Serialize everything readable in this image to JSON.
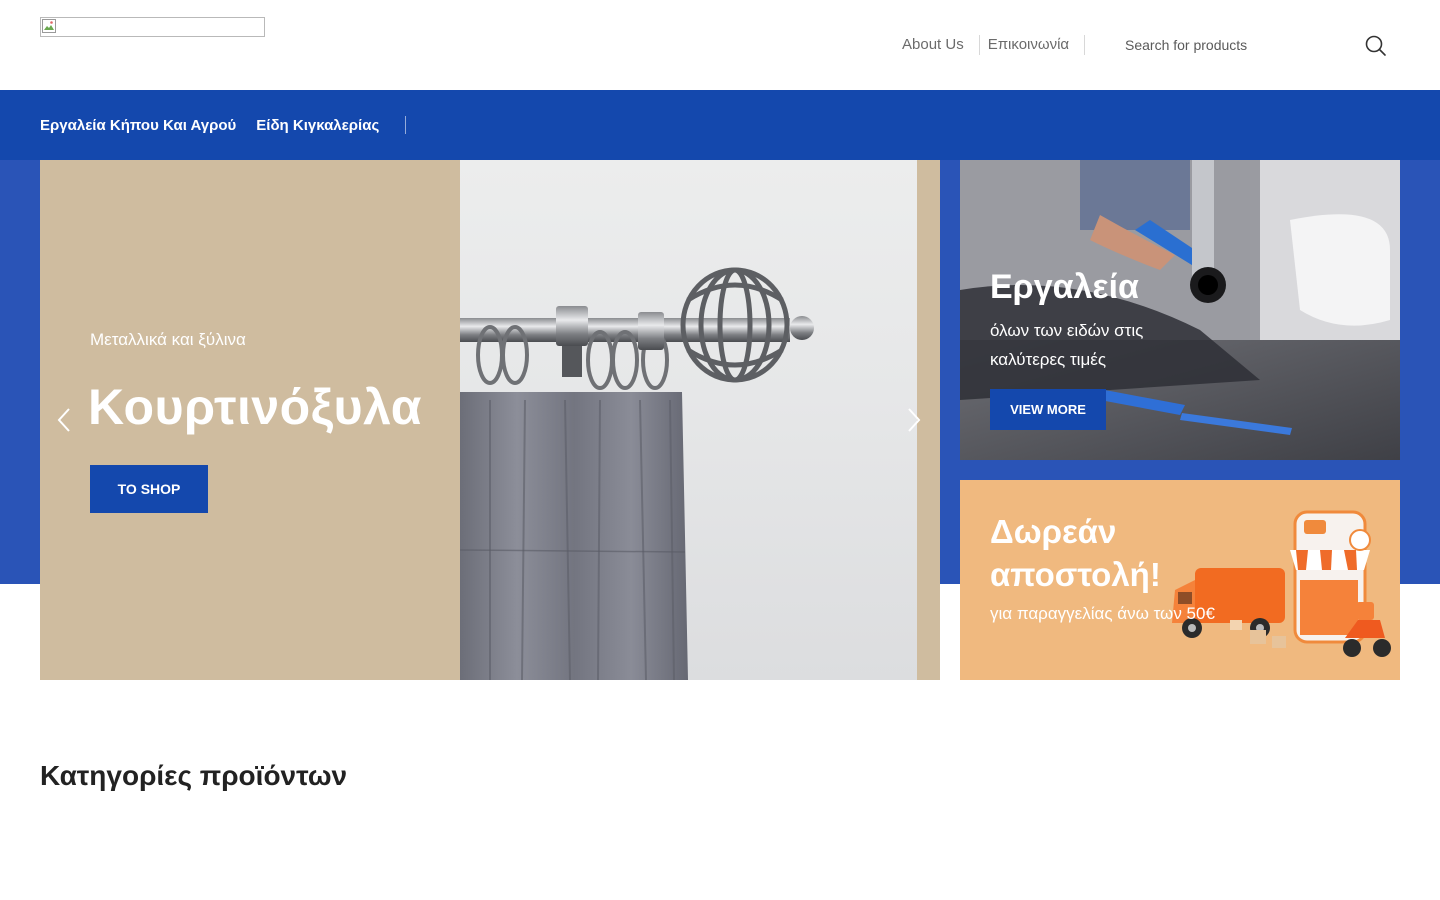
{
  "header": {
    "logo_alt": "",
    "nav": [
      {
        "label": "About Us"
      },
      {
        "label": "Επικοινωνία"
      }
    ],
    "search": {
      "placeholder": "Search for products",
      "icon": "search-icon"
    }
  },
  "categories": [
    {
      "label": "Εργαλεία Κήπου Και Αγρού"
    },
    {
      "label": "Είδη Κιγκαλερίας"
    }
  ],
  "slider": {
    "subtitle": "Μεταλλικά και ξύλινα",
    "title": "Κουρτινόξυλα",
    "button": "TO SHOP",
    "prev_icon": "chevron-left-icon",
    "next_icon": "chevron-right-icon"
  },
  "promo_tools": {
    "title": "Εργαλεία",
    "subtitle": "όλων των ειδών στις καλύτερες τιμές",
    "button": "VIEW MORE"
  },
  "promo_delivery": {
    "title": "Δωρεάν αποστολή!",
    "subtitle": "για παραγγελίας άνω των 50€"
  },
  "section": {
    "title": "Κατηγορίες προϊόντων"
  },
  "colors": {
    "primary": "#1448ad",
    "hero_backdrop": "#2a54b7",
    "slide_bg": "#cfbc9f",
    "delivery_bg": "#f0b97f"
  }
}
